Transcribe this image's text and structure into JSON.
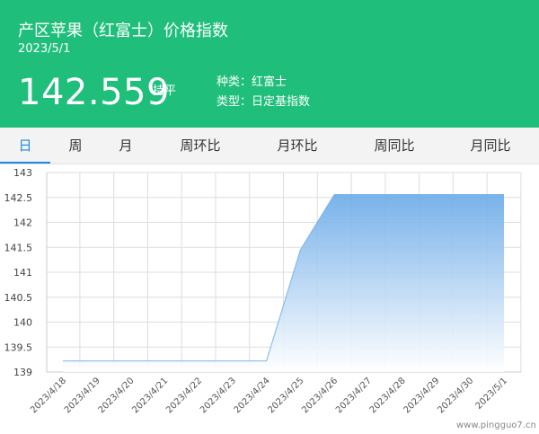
{
  "header": {
    "title": "产区苹果（红富士）价格指数",
    "date": "2023/5/1",
    "price": "142.559",
    "change": "持平",
    "variety": "种类：红富士",
    "type": "类型：日定基指数"
  },
  "tabs": [
    {
      "label": "日",
      "active": true
    },
    {
      "label": "周",
      "active": false
    },
    {
      "label": "月",
      "active": false
    },
    {
      "label": "周环比",
      "active": false
    },
    {
      "label": "月环比",
      "active": false
    },
    {
      "label": "周同比",
      "active": false
    },
    {
      "label": "月同比",
      "active": false
    }
  ],
  "chart_data": {
    "type": "area",
    "x": [
      "2023/4/18",
      "2023/4/19",
      "2023/4/20",
      "2023/4/21",
      "2023/4/22",
      "2023/4/23",
      "2023/4/24",
      "2023/4/25",
      "2023/4/26",
      "2023/4/27",
      "2023/4/28",
      "2023/4/29",
      "2023/4/30",
      "2023/5/1"
    ],
    "series": [
      {
        "values": [
          139.22,
          139.22,
          139.22,
          139.22,
          139.22,
          139.22,
          139.22,
          141.45,
          142.559,
          142.559,
          142.559,
          142.559,
          142.559,
          142.559
        ]
      }
    ],
    "yticks": [
      "143",
      "142.5",
      "142",
      "141.5",
      "141",
      "140.5",
      "140",
      "139.5",
      "139"
    ],
    "ylim": [
      139,
      143
    ],
    "grid": true,
    "colors": {
      "line": "#7ab4e8",
      "fill_top": "#6aaae8",
      "fill_bottom": "#ffffff",
      "grid": "#dddddd"
    }
  },
  "watermark": "www.pingguo7.cn"
}
